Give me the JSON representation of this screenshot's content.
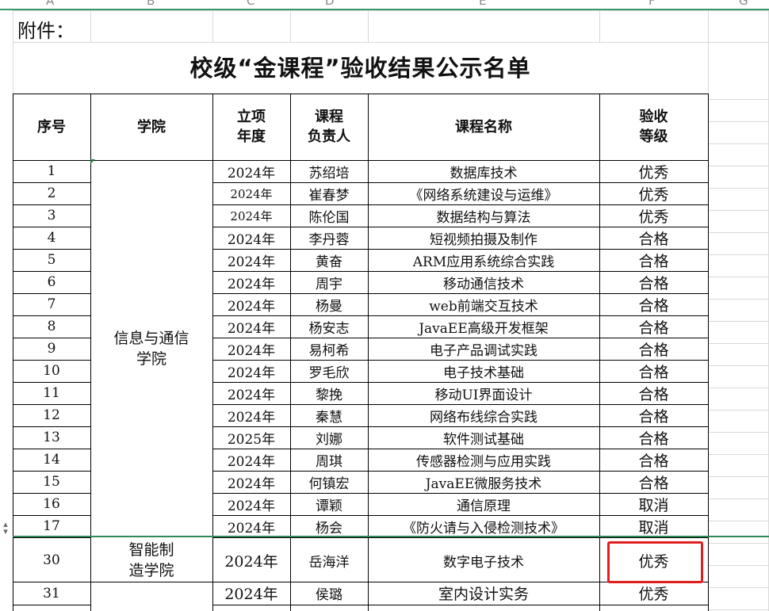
{
  "columns": [
    "A",
    "B",
    "C",
    "D",
    "E",
    "F",
    "G"
  ],
  "attachment_label": "附件：",
  "title": "校级“金课程”验收结果公示名单",
  "headers": {
    "seq": "序号",
    "college": "学院",
    "year": "立项\n年度",
    "leader": "课程\n负责人",
    "course": "课程名称",
    "grade": "验收\n等级"
  },
  "group1_college": "信息与通信\n学院",
  "group2_college": "智能制\n造学院",
  "rows": [
    {
      "seq": "1",
      "year": "2024年",
      "leader": "苏绍培",
      "course": "数据库技术",
      "grade": "优秀"
    },
    {
      "seq": "2",
      "year": "2024年",
      "leader": "崔春梦",
      "course": "《网络系统建设与运维》",
      "grade": "优秀"
    },
    {
      "seq": "3",
      "year": "2024年",
      "leader": "陈伦国",
      "course": "数据结构与算法",
      "grade": "优秀"
    },
    {
      "seq": "4",
      "year": "2024年",
      "leader": "李丹蓉",
      "course": "短视频拍摄及制作",
      "grade": "合格"
    },
    {
      "seq": "5",
      "year": "2024年",
      "leader": "黄奋",
      "course": "ARM应用系统综合实践",
      "grade": "合格"
    },
    {
      "seq": "6",
      "year": "2024年",
      "leader": "周宇",
      "course": "移动通信技术",
      "grade": "合格"
    },
    {
      "seq": "7",
      "year": "2024年",
      "leader": "杨曼",
      "course": "web前端交互技术",
      "grade": "合格"
    },
    {
      "seq": "8",
      "year": "2024年",
      "leader": "杨安志",
      "course": "JavaEE高级开发框架",
      "grade": "合格"
    },
    {
      "seq": "9",
      "year": "2024年",
      "leader": "易柯希",
      "course": "电子产品调试实践",
      "grade": "合格"
    },
    {
      "seq": "10",
      "year": "2024年",
      "leader": "罗毛欣",
      "course": "电子技术基础",
      "grade": "合格"
    },
    {
      "seq": "11",
      "year": "2024年",
      "leader": "黎挽",
      "course": "移动UI界面设计",
      "grade": "合格"
    },
    {
      "seq": "12",
      "year": "2024年",
      "leader": "秦慧",
      "course": "网络布线综合实践",
      "grade": "合格"
    },
    {
      "seq": "13",
      "year": "2025年",
      "leader": "刘娜",
      "course": "软件测试基础",
      "grade": "合格"
    },
    {
      "seq": "14",
      "year": "2024年",
      "leader": "周琪",
      "course": "传感器检测与应用实践",
      "grade": "合格"
    },
    {
      "seq": "15",
      "year": "2024年",
      "leader": "何镇宏",
      "course": "JavaEE微服务技术",
      "grade": "合格"
    },
    {
      "seq": "16",
      "year": "2024年",
      "leader": "谭颖",
      "course": "通信原理",
      "grade": "取消"
    },
    {
      "seq": "17",
      "year": "2024年",
      "leader": "杨会",
      "course": "《防火请与入侵检测技术》",
      "grade": "取消"
    }
  ],
  "row30": {
    "seq": "30",
    "year": "2024年",
    "leader": "岳海洋",
    "course": "数字电子技术",
    "grade": "优秀"
  },
  "row31": {
    "seq": "31",
    "year": "2024年",
    "leader": "侯璐",
    "course": "室内设计实务",
    "grade": "优秀"
  }
}
